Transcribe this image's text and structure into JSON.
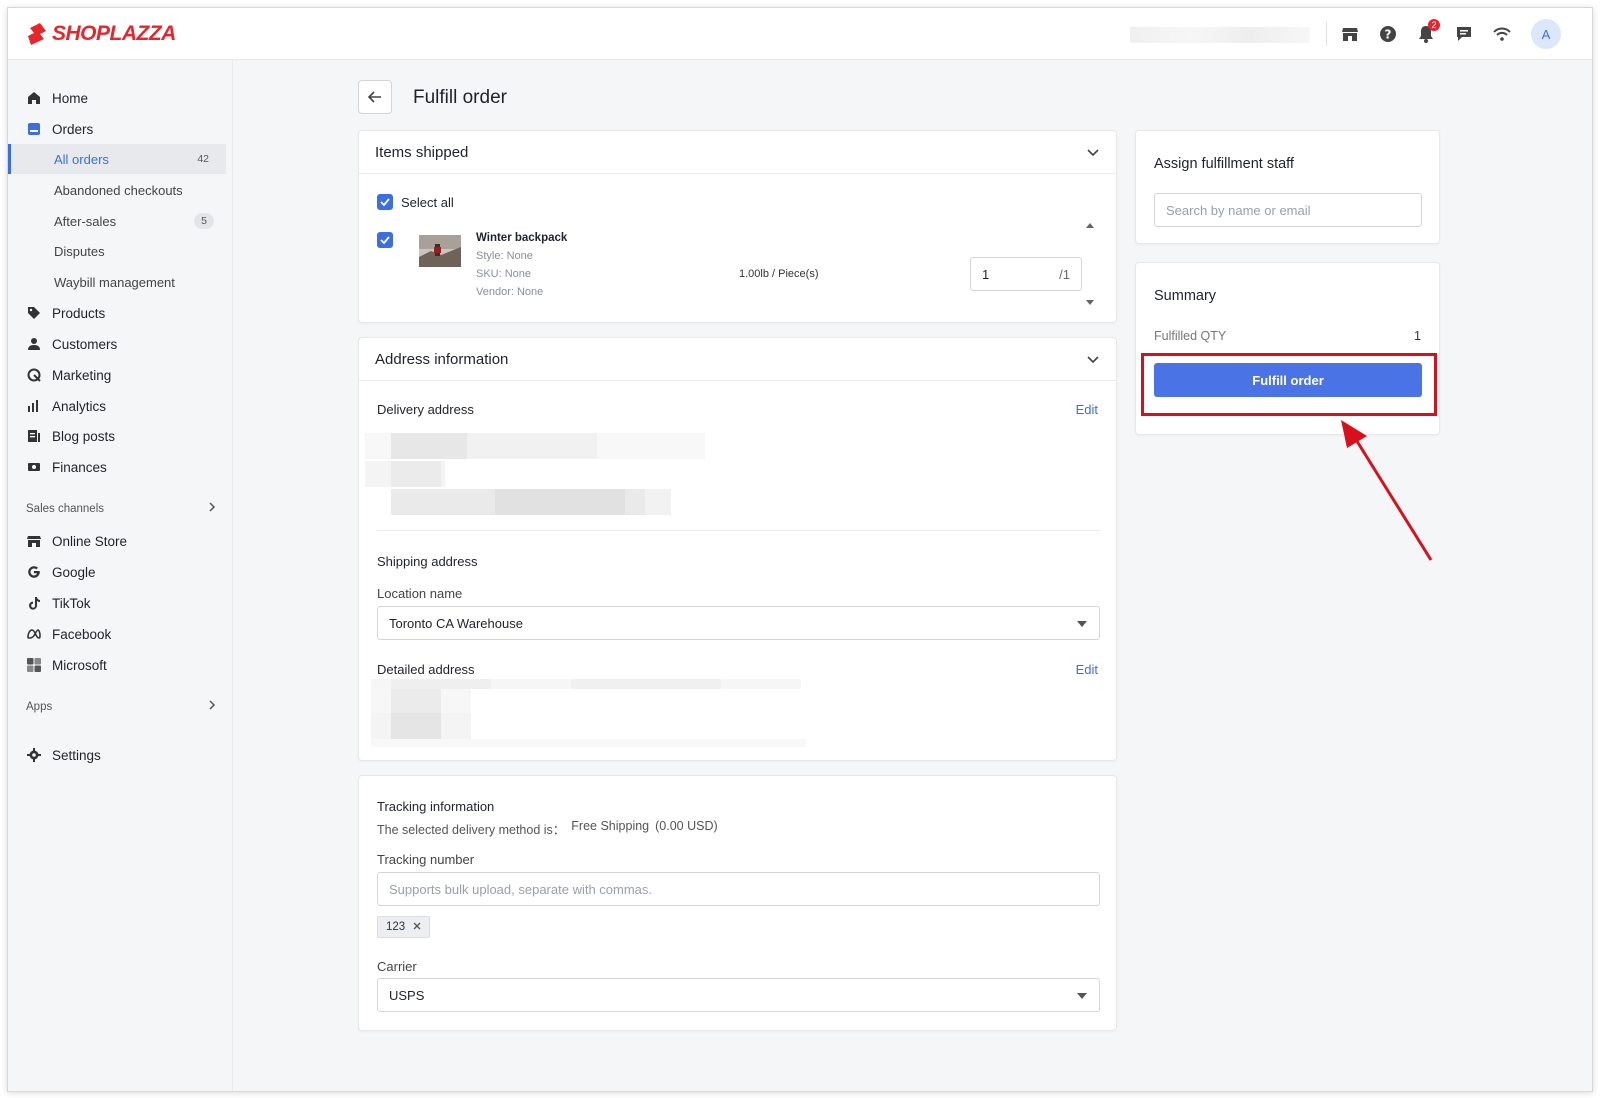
{
  "brand": {
    "name": "SHOPLAZZA",
    "color": "#e9242a"
  },
  "topbar": {
    "icons": [
      "store-icon",
      "help-icon",
      "bell-icon",
      "chat-icon",
      "wifi-icon"
    ],
    "notification_count": "2",
    "avatar_initial": "A"
  },
  "sidebar": {
    "home": "Home",
    "orders": "Orders",
    "orders_sub": [
      {
        "label": "All orders",
        "count": "42"
      },
      {
        "label": "Abandoned checkouts",
        "count": ""
      },
      {
        "label": "After-sales",
        "count": "5"
      },
      {
        "label": "Disputes",
        "count": ""
      },
      {
        "label": "Waybill management",
        "count": ""
      }
    ],
    "products": "Products",
    "customers": "Customers",
    "marketing": "Marketing",
    "analytics": "Analytics",
    "blog_posts": "Blog posts",
    "finances": "Finances",
    "sales_channels_label": "Sales channels",
    "online_store": "Online Store",
    "google": "Google",
    "tiktok": "TikTok",
    "facebook": "Facebook",
    "microsoft": "Microsoft",
    "apps_label": "Apps",
    "settings": "Settings"
  },
  "page": {
    "title": "Fulfill order"
  },
  "items_shipped": {
    "title": "Items shipped",
    "select_all": "Select all",
    "item": {
      "name": "Winter backpack",
      "style": "Style: None",
      "sku": "SKU: None",
      "vendor": "Vendor: None",
      "weight": "1.00lb / Piece(s)",
      "qty": "1",
      "qty_total": "/1"
    }
  },
  "address": {
    "title": "Address information",
    "delivery_label": "Delivery address",
    "edit": "Edit",
    "shipping_label": "Shipping address",
    "location_label": "Location name",
    "location_value": "Toronto CA Warehouse",
    "detailed_label": "Detailed address"
  },
  "tracking": {
    "title": "Tracking information",
    "method_prefix": "The selected delivery method is：",
    "method": "Free Shipping",
    "method_price": "(0.00 USD)",
    "number_label": "Tracking number",
    "number_placeholder": "Supports bulk upload, separate with commas.",
    "tag": "123",
    "carrier_label": "Carrier",
    "carrier_value": "USPS"
  },
  "staff": {
    "title": "Assign fulfillment staff",
    "placeholder": "Search by name or email"
  },
  "summary": {
    "title": "Summary",
    "fulfilled_qty_label": "Fulfilled QTY",
    "fulfilled_qty_value": "1",
    "button": "Fulfill order"
  },
  "colors": {
    "accent": "#3b6fe0",
    "button": "#4a74e6",
    "annotation": "#d9101c"
  }
}
